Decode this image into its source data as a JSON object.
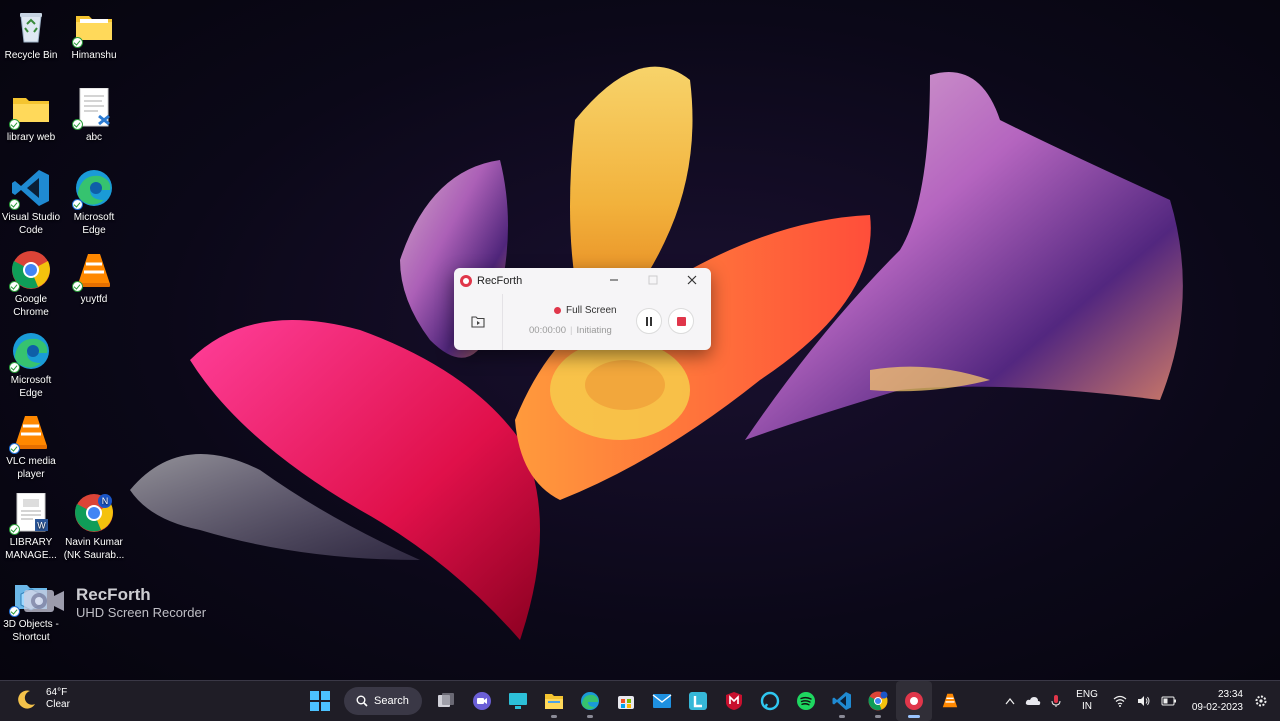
{
  "desktop": {
    "icons": [
      {
        "label": "Recycle Bin",
        "icon": "recycle-bin-icon"
      },
      {
        "label": "Himanshu",
        "icon": "folder-icon"
      },
      {
        "label": "library web",
        "icon": "folder-icon"
      },
      {
        "label": "abc",
        "icon": "document-icon"
      },
      {
        "label": "Visual Studio Code",
        "icon": "vscode-icon"
      },
      {
        "label": "Microsoft Edge",
        "icon": "edge-icon"
      },
      {
        "label": "Google Chrome",
        "icon": "chrome-icon"
      },
      {
        "label": "yuytfd",
        "icon": "vlc-icon"
      },
      {
        "label": "Microsoft Edge",
        "icon": "edge-icon"
      },
      {
        "label": "VLC media player",
        "icon": "vlc-icon"
      },
      {
        "label": "LIBRARY MANAGE...",
        "icon": "word-document-icon"
      },
      {
        "label": "Navin Kumar (NK Saurab...",
        "icon": "chrome-profile-icon"
      },
      {
        "label": "3D Objects - Shortcut",
        "icon": "3d-objects-icon"
      }
    ]
  },
  "recforth": {
    "title": "RecForth",
    "mode": "Full Screen",
    "time": "00:00:00",
    "status": "Initiating",
    "accent": "#e0364a"
  },
  "watermark": {
    "name": "RecForth",
    "tagline": "UHD Screen Recorder"
  },
  "taskbar": {
    "weather_temp": "64°F",
    "weather_cond": "Clear",
    "search_label": "Search",
    "apps": [
      "start-icon",
      "search",
      "task-view-icon",
      "teams-chat-icon",
      "desktop-app-icon",
      "file-explorer-icon",
      "edge-icon",
      "store-icon",
      "mail-icon",
      "l-app-icon",
      "mcafee-icon",
      "alexa-icon",
      "spotify-icon",
      "vscode-icon",
      "chrome-profile-icon",
      "recforth-icon",
      "vlc-icon"
    ],
    "lang_top": "ENG",
    "lang_bottom": "IN",
    "time": "23:34",
    "date": "09-02-2023"
  }
}
